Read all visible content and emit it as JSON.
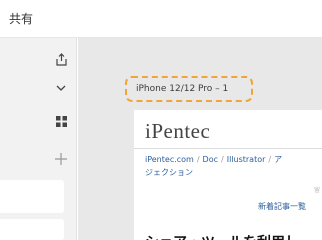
{
  "toolbar": {
    "share_label": "共有"
  },
  "left_panel": {
    "icons": [
      "share-export-icon",
      "chevron-down-icon",
      "grid-icon",
      "plus-icon"
    ]
  },
  "canvas": {
    "frame_label": "iPhone 12/12 Pro – 1",
    "site": {
      "logo": "iPentec",
      "breadcrumb": [
        "iPentec.com",
        "Doc",
        "Illustrator",
        "ア"
      ],
      "breadcrumb_cont": "ジェクション",
      "faint_text": "留",
      "new_articles": "新着記事一覧",
      "heading": "シェア・ツールを利用し"
    }
  },
  "colors": {
    "frame_label_border": "#f0a53a",
    "link": "#2c5e9e",
    "canvas_bg": "#e8e8e8"
  }
}
